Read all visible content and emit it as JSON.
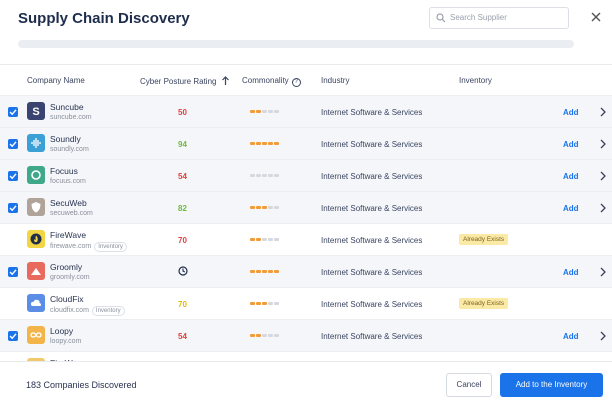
{
  "header": {
    "title": "Supply Chain Discovery",
    "search_placeholder": "Search Supplier",
    "discovery_progress": 0
  },
  "columns": {
    "company": "Company Name",
    "rating": "Cyber Posture Rating",
    "commonality": "Commonality",
    "industry": "Industry",
    "inventory": "Inventory"
  },
  "colors": {
    "accent": "#1a73e8",
    "rating_red": "#e0413a",
    "rating_green": "#6dbb3c",
    "rating_yellow": "#e6b800",
    "commonality_on": "#f39c37",
    "commonality_off": "#d5d8de",
    "badge_bg": "#fbe9a6"
  },
  "rows": [
    {
      "name": "Suncube",
      "domain": "suncube.com",
      "checked": true,
      "rating": "50",
      "rating_color": "#e0413a",
      "commonality_level": 2,
      "industry": "Internet Software & Services",
      "add_label": "Add",
      "logo_bg": "#3a4470",
      "logo_icon": "s-icon"
    },
    {
      "name": "Soundly",
      "domain": "soundly.com",
      "checked": true,
      "rating": "94",
      "rating_color": "#6dbb3c",
      "commonality_level": 5,
      "industry": "Internet Software & Services",
      "add_label": "Add",
      "logo_bg": "#3aa0d6",
      "logo_icon": "soundwave-icon"
    },
    {
      "name": "Focuus",
      "domain": "focuus.com",
      "checked": true,
      "rating": "54",
      "rating_color": "#e0413a",
      "commonality_level": 0,
      "industry": "Internet Software & Services",
      "add_label": "Add",
      "logo_bg": "#3ea889",
      "logo_icon": "circle-icon"
    },
    {
      "name": "SecuWeb",
      "domain": "secuweb.com",
      "checked": true,
      "rating": "82",
      "rating_color": "#6dbb3c",
      "commonality_level": 3,
      "industry": "Internet Software & Services",
      "add_label": "Add",
      "logo_bg": "#b0a39a",
      "logo_icon": "shield-icon"
    },
    {
      "name": "FireWave",
      "domain": "firewave.com",
      "inventory_tag": "Inventory",
      "checked": false,
      "rating": "70",
      "rating_color": "#e0413a",
      "commonality_level": 2,
      "industry": "Internet Software & Services",
      "inventory_badge": "Already Exists",
      "logo_bg": "#f2d542",
      "logo_icon": "flame-icon"
    },
    {
      "name": "Groomly",
      "domain": "groomly.com",
      "checked": true,
      "rating_icon": "clock-icon",
      "commonality_level": 5,
      "industry": "Internet Software & Services",
      "add_label": "Add",
      "logo_bg": "#e86a5e",
      "logo_icon": "mountain-icon"
    },
    {
      "name": "CloudFix",
      "domain": "cloudfix.com",
      "inventory_tag": "Inventory",
      "checked": false,
      "rating": "70",
      "rating_color": "#e6b800",
      "commonality_level": 3,
      "industry": "Internet Software & Services",
      "inventory_badge": "Already Exists",
      "logo_bg": "#5b8de6",
      "logo_icon": "cloud-icon"
    },
    {
      "name": "Loopy",
      "domain": "loopy.com",
      "checked": true,
      "rating": "54",
      "rating_color": "#e0413a",
      "commonality_level": 2,
      "industry": "Internet Software & Services",
      "add_label": "Add",
      "logo_bg": "#f3b54a",
      "logo_icon": "infinity-icon"
    },
    {
      "name": "FireWave",
      "domain": "",
      "checked": false,
      "rating": "",
      "commonality_level": 0,
      "industry": "",
      "logo_bg": "#f2c96a",
      "logo_icon": "flame-icon"
    }
  ],
  "footer": {
    "count_text": "183 Companies Discovered",
    "cancel_label": "Cancel",
    "primary_label": "Add to the Inventory"
  }
}
